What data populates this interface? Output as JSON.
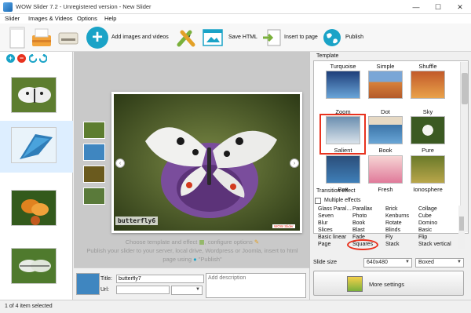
{
  "window": {
    "title": "WOW Slider 7.2 - Unregistered version - New Slider",
    "min": "—",
    "max": "☐",
    "close": "✕"
  },
  "menu": [
    "Slider",
    "Images & Videos",
    "Options",
    "Help"
  ],
  "toolbar": {
    "add_images_label": "Add images and videos",
    "save_html_label": "Save HTML",
    "insert_label": "Insert to page",
    "publish_label": "Publish"
  },
  "left_panel": {
    "add": "+",
    "remove": "−",
    "thumbs": [
      "butterfly1",
      "butterfly2",
      "butterfly3",
      "butterfly4"
    ]
  },
  "slider": {
    "caption": "butterfly6",
    "badge": "WOW Slider",
    "instructions": [
      "Choose template and effect ",
      ", configure options ",
      "Publish your slider to your server, local drive, Wordpress or Joomla, insert to html",
      "page using ",
      "\"Publish\""
    ]
  },
  "edit": {
    "title_label": "Title:",
    "title_value": "butterfly7",
    "url_label": "Url:",
    "url_value": "",
    "description_placeholder": "Add description"
  },
  "status": "1 of 4 item selected",
  "template": {
    "heading": "Template",
    "items": [
      "Turquoise",
      "Simple",
      "Shuffle",
      "Zoom",
      "Dot",
      "Sky",
      "Salient",
      "Book",
      "Pure",
      "Box",
      "Fresh",
      "Ionosphere"
    ],
    "selected": "Salient"
  },
  "transition": {
    "heading": "Transition effect",
    "multiple_label": "Multiple effects",
    "columns": [
      [
        "Glass Paral…",
        "Seven",
        "Blur",
        "Slices",
        "Basic linear",
        "Page"
      ],
      [
        "Parallax",
        "Photo",
        "Book",
        "Blast",
        "Fade",
        "Squares"
      ],
      [
        "Brick",
        "Kenburns",
        "Rotate",
        "Blinds",
        "Fly",
        "Stack"
      ],
      [
        "Collage",
        "Cube",
        "Domino",
        "Basic",
        "Flip",
        "Stack vertical"
      ]
    ],
    "selected": "Squares"
  },
  "slide_size": {
    "label": "Slide size",
    "size": "640x480",
    "mode": "Boxed"
  },
  "more_settings_label": "More settings",
  "colors": {
    "accent_red": "#e8321e",
    "highlight_blue": "#3399ff",
    "teal": "#1aa3c7"
  }
}
